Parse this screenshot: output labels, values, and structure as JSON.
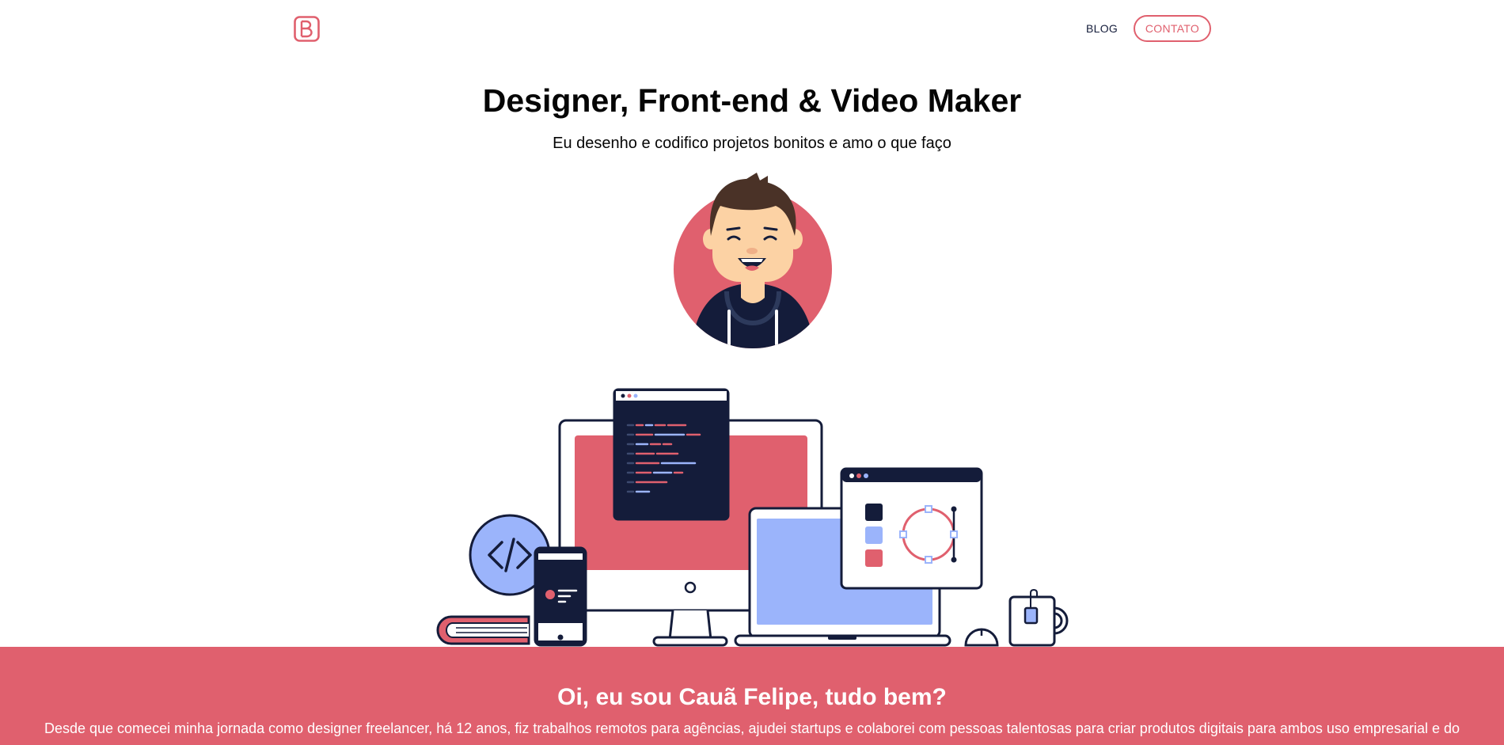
{
  "header": {
    "logo_icon": "brand-logo-icon",
    "nav": {
      "blog_label": "BLOG",
      "contact_label": "CONTATO"
    }
  },
  "hero": {
    "title": "Designer, Front-end & Video Maker",
    "subtitle": "Eu desenho e codifico projetos bonitos e amo o que faço"
  },
  "intro": {
    "title": "Oi, eu sou Cauã Felipe, tudo bem?",
    "text": "Desde que comecei minha jornada como designer freelancer, há 12 anos, fiz trabalhos remotos para agências, ajudei startups e colaborei com pessoas talentosas para criar produtos digitais para ambos uso empresarial e do"
  },
  "colors": {
    "accent": "#e0606e",
    "navy": "#141c3a",
    "periwinkle": "#9bb4fb",
    "white": "#ffffff"
  }
}
